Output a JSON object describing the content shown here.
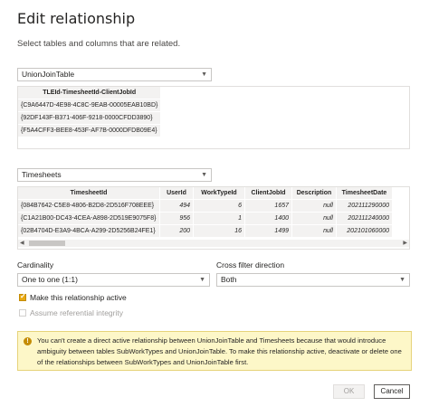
{
  "dialog": {
    "title": "Edit relationship",
    "subtitle": "Select tables and columns that are related."
  },
  "table1": {
    "selected": "UnionJoinTable",
    "headers": [
      "TLEId-TimesheetId-ClientJobId"
    ],
    "rows": [
      [
        "{C9A6447D-4E98-4C8C-9EAB-00005EAB10BD}"
      ],
      [
        "{92DF143F-B371-406F-9218-0000CFDD3890}"
      ],
      [
        "{F5A4CFF3-BEE8-453F-AF7B-0000DFDB09E4}"
      ]
    ]
  },
  "table2": {
    "selected": "Timesheets",
    "headers": [
      "TimesheetId",
      "UserId",
      "WorkTypeId",
      "ClientJobId",
      "Description",
      "TimesheetDate"
    ],
    "rows": [
      [
        "{084B7642-C5E8-4806-B2D8-2D516F708EEE}",
        "494",
        "6",
        "1657",
        "null",
        "202111290000"
      ],
      [
        "{C1A21B00-DC43-4CEA-A898-2D519E9075F8}",
        "956",
        "1",
        "1400",
        "null",
        "202111240000"
      ],
      [
        "{02B4704D-E3A9-4BCA-A299-2D5256B24FE1}",
        "200",
        "16",
        "1499",
        "null",
        "202101060000"
      ]
    ]
  },
  "cardinality": {
    "label": "Cardinality",
    "selected": "One to one (1:1)"
  },
  "cross_filter": {
    "label": "Cross filter direction",
    "selected": "Both"
  },
  "options": {
    "active_label": "Make this relationship active",
    "active_checked": true,
    "referential_label": "Assume referential integrity",
    "referential_checked": false
  },
  "warning": {
    "text": "You can't create a direct active relationship between UnionJoinTable and Timesheets because that would introduce ambiguity between tables SubWorkTypes and UnionJoinTable. To make this relationship active, deactivate or delete one of the relationships between SubWorkTypes and UnionJoinTable first."
  },
  "buttons": {
    "ok": "OK",
    "cancel": "Cancel"
  },
  "icons": {
    "dropdown": "chevron-down-icon",
    "warning": "warning-icon",
    "check": "checkmark-icon"
  },
  "colors": {
    "accent": "#e8a812",
    "warning_bg": "#fdf7c8"
  }
}
